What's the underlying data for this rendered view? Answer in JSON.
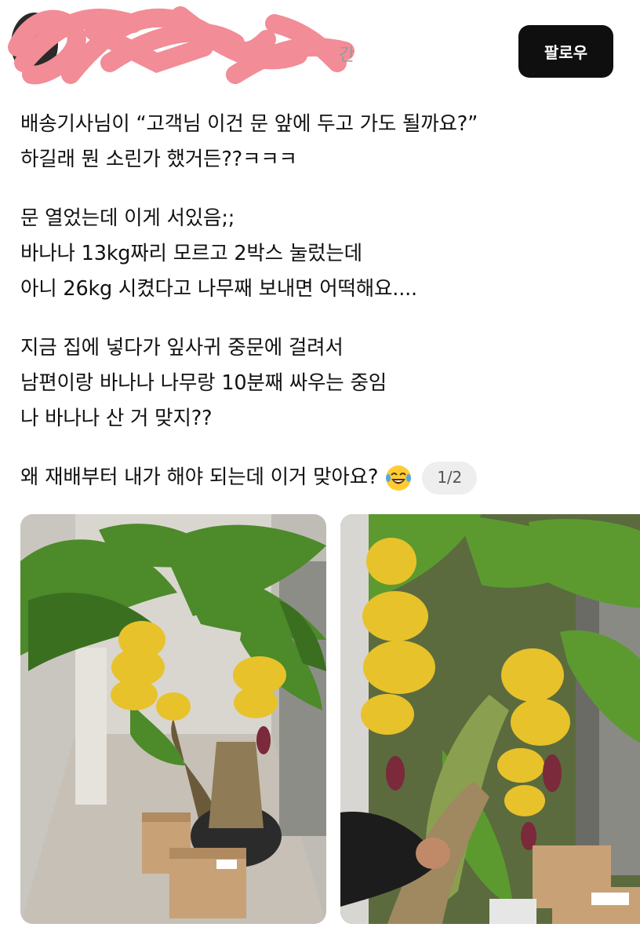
{
  "header": {
    "time_fragment": "간",
    "follow_label": "팔로우"
  },
  "post": {
    "paragraphs": [
      [
        "배송기사님이 “고객님 이건 문 앞에 두고 가도 될까요?”",
        "하길래 뭔 소린가 했거든??ㅋㅋㅋ"
      ],
      [
        "문 열었는데 이게 서있음;;",
        "바나나 13kg짜리 모르고 2박스 눌렀는데",
        "아니 26kg 시켰다고 나무째 보내면 어떡해요...."
      ],
      [
        "지금 집에 넣다가 잎사귀 중문에 걸려서",
        "남편이랑 바나나 나무랑 10분째 싸우는 중임",
        "나 바나나 산 거 맞지??"
      ]
    ],
    "last_line": "왜 재배부터 내가 해야 되는데 이거 맞아요?",
    "emoji": "laughing-tears-emoji",
    "image_counter": "1/2"
  },
  "photos": [
    {
      "icon": "banana-tree-hallway-photo"
    },
    {
      "icon": "banana-tree-closeup-photo"
    }
  ],
  "colors": {
    "follow_bg": "#0f0f0f",
    "censor": "#f28c96",
    "leaf": "#4c8a2a",
    "banana": "#e8c22a"
  }
}
